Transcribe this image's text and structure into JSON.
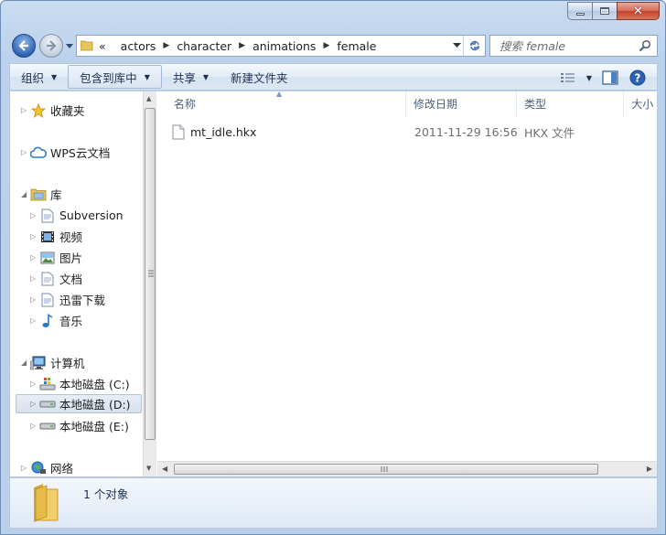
{
  "address": {
    "prefix": "«",
    "crumbs": [
      "actors",
      "character",
      "animations",
      "female"
    ]
  },
  "search": {
    "placeholder": "搜索 female"
  },
  "toolbar": {
    "organize": "组织",
    "include_in_library": "包含到库中",
    "share": "共享",
    "new_folder": "新建文件夹"
  },
  "nav": {
    "favorites": "收藏夹",
    "wps": "WPS云文档",
    "libraries": "库",
    "subversion": "Subversion",
    "videos": "视频",
    "pictures": "图片",
    "documents": "文档",
    "xunlei": "迅雷下载",
    "music": "音乐",
    "computer": "计算机",
    "drive_c": "本地磁盘 (C:)",
    "drive_d": "本地磁盘 (D:)",
    "drive_e": "本地磁盘 (E:)",
    "network": "网络"
  },
  "columns": {
    "name": "名称",
    "modified": "修改日期",
    "type": "类型",
    "size": "大小"
  },
  "files": [
    {
      "name": "mt_idle.hkx",
      "modified": "2011-11-29 16:56",
      "type": "HKX 文件"
    }
  ],
  "status": {
    "count": "1 个对象"
  },
  "colors": {
    "accent": "#2e64b6",
    "close": "#c4422a",
    "folder": "#e8c45c"
  }
}
